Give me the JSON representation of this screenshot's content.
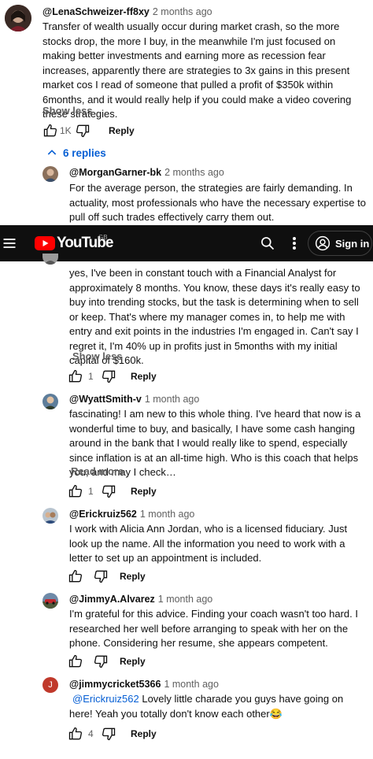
{
  "top_comment": {
    "author": "@LenaSchweizer-ff8xy",
    "time": "2 months ago",
    "text": "Transfer of wealth usually occur during market crash, so the more stocks drop, the more I buy, in the meanwhile I'm just focused on making better investments and earning more as recession fear increases, apparently there are strategies to 3x gains in this present market cos I read of someone that pulled a profit of $350k within 6months, and it would really help if you could make a video covering these strategies.",
    "toggle": "Show less",
    "likes": "1K",
    "reply_label": "Reply"
  },
  "replies_toggle": {
    "label": "6 replies"
  },
  "reply_morgan": {
    "author": "@MorganGarner-bk",
    "time": "2 months ago",
    "text": "For the average person, the strategies are fairly demanding. In actuality, most professionals who have the necessary expertise to pull off such trades effectively carry them out."
  },
  "navbar": {
    "logo_text": "YouTube",
    "region": "GB",
    "signin_label": "Sign in"
  },
  "reply_hidden": {
    "text": "yes, I've been in constant touch with a Financial Analyst for approximately 8 months. You know, these days it's really easy to buy into trending stocks, but the task is determining when to sell or keep. That's where my manager comes in, to help me with entry and exit points in the industries I'm engaged in. Can't say I regret it, I'm 40% up in profits just in 5months with my initial capital of $160k.",
    "toggle": "Show less",
    "likes": "1",
    "reply_label": "Reply"
  },
  "reply_wyatt": {
    "author": "@WyattSmith-v",
    "time": "1 month ago",
    "text": "fascinating! I am new to this whole thing. I've heard that now is a wonderful time to buy, and basically, I have some cash hanging around in the bank that I would really like to spend, especially since inflation is at an all-time high. Who is this coach that helps you, and may I check…",
    "toggle": "Read more",
    "likes": "1",
    "reply_label": "Reply"
  },
  "reply_erick": {
    "author": "@Erickruiz562",
    "time": "1 month ago",
    "text": "I work with Alicia Ann Jordan, who is a licensed fiduciary. Just look up the name. All the information you need to work with a letter to set up an appointment is included.",
    "likes": "",
    "reply_label": "Reply"
  },
  "reply_jimmy": {
    "author": "@JimmyA.Alvarez",
    "time": "1 month ago",
    "text": "I'm grateful for this advice. Finding your coach wasn't too hard. I researched her well before arranging to speak with her on the phone. Considering her resume, she appears competent.",
    "likes": "",
    "reply_label": "Reply"
  },
  "reply_cricket": {
    "avatar_letter": "J",
    "author": "@jimmycricket5366",
    "time": "1 month ago",
    "mention": "@Erickruiz562",
    "text": " Lovely little charade you guys have going on here! Yeah you totally don't know each other😂",
    "likes": "4",
    "reply_label": "Reply"
  },
  "colors": {
    "youtube_red": "#ff0000",
    "link_blue": "#065fd4",
    "navbar_bg": "#0f0f0f",
    "avatar_j": "#c0392b"
  }
}
